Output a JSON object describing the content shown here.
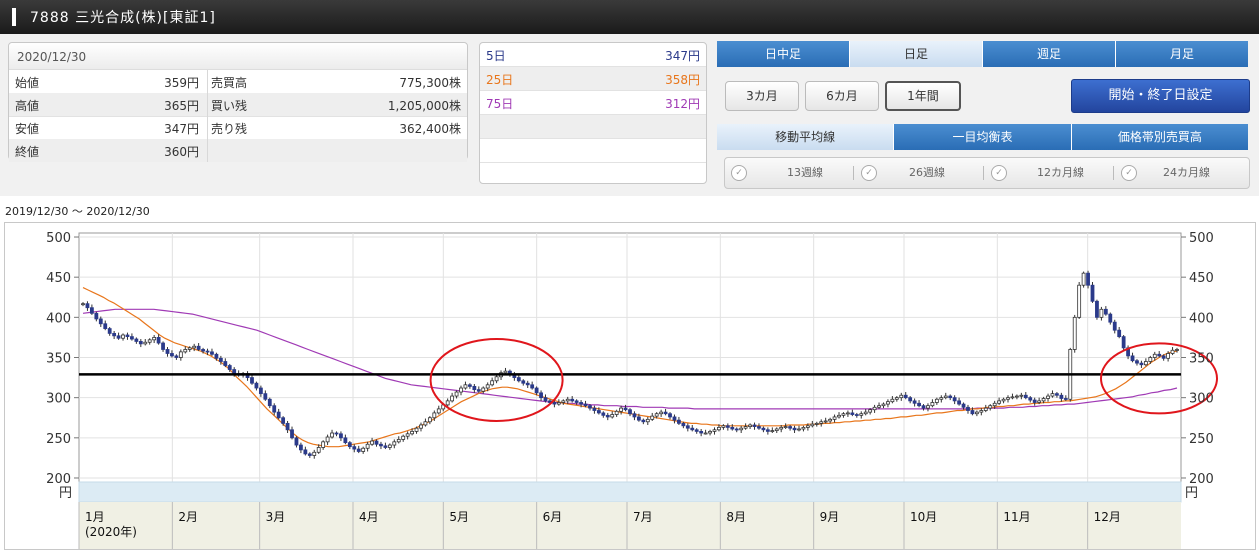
{
  "header": {
    "title": "7888 三光合成(株)[東証1]"
  },
  "quote": {
    "date": "2020/12/30",
    "rows": [
      {
        "label": "始値",
        "value": "359円",
        "label2": "売買高",
        "value2": "775,300株"
      },
      {
        "label": "高値",
        "value": "365円",
        "label2": "買い残",
        "value2": "1,205,000株"
      },
      {
        "label": "安値",
        "value": "347円",
        "label2": "売り残",
        "value2": "362,400株"
      },
      {
        "label": "終値",
        "value": "360円",
        "label2": "",
        "value2": ""
      }
    ]
  },
  "ma": {
    "rows": [
      {
        "label": "5日",
        "value": "347円",
        "color": "#2b3a8a"
      },
      {
        "label": "25日",
        "value": "358円",
        "color": "#e8761c"
      },
      {
        "label": "75日",
        "value": "312円",
        "color": "#a03ab5"
      }
    ]
  },
  "tabs": {
    "period": [
      "日中足",
      "日足",
      "週足",
      "月足"
    ],
    "period_selected": 1
  },
  "ranges": {
    "items": [
      "3カ月",
      "6カ月",
      "1年間"
    ],
    "selected": 2
  },
  "set_button": "開始・終了日設定",
  "tabs2": {
    "items": [
      "移動平均線",
      "一目均衡表",
      "価格帯別売買高"
    ],
    "selected": 0
  },
  "lines": {
    "items": [
      "13週線",
      "26週線",
      "12カ月線",
      "24カ月線"
    ]
  },
  "chart_range": "2019/12/30 〜 2020/12/30",
  "colors": {
    "up": "#ffffff",
    "down": "#2b3a8a",
    "ma25": "#e8761c",
    "ma75": "#a03ab5",
    "annotation": "#e0161c"
  },
  "chart_data": {
    "type": "candlestick",
    "ylim": [
      195,
      505
    ],
    "yticks": [
      200,
      250,
      300,
      350,
      400,
      450,
      500
    ],
    "y_unit": "円",
    "months": [
      "1月",
      "2月",
      "3月",
      "4月",
      "5月",
      "6月",
      "7月",
      "8月",
      "9月",
      "10月",
      "11月",
      "12月"
    ],
    "year_label": "(2020年)",
    "close": [
      417,
      412,
      405,
      398,
      392,
      386,
      380,
      377,
      374,
      378,
      376,
      373,
      370,
      367,
      369,
      372,
      375,
      368,
      360,
      355,
      352,
      350,
      357,
      360,
      362,
      364,
      360,
      358,
      357,
      354,
      349,
      345,
      340,
      335,
      330,
      328,
      330,
      325,
      318,
      312,
      305,
      298,
      290,
      282,
      275,
      268,
      260,
      250,
      241,
      235,
      230,
      228,
      232,
      238,
      245,
      251,
      256,
      255,
      250,
      244,
      239,
      236,
      233,
      237,
      242,
      246,
      242,
      240,
      238,
      241,
      245,
      248,
      252,
      255,
      258,
      262,
      266,
      270,
      275,
      281,
      286,
      291,
      296,
      302,
      307,
      312,
      316,
      314,
      310,
      308,
      312,
      316,
      321,
      326,
      331,
      333,
      329,
      325,
      321,
      318,
      316,
      312,
      306,
      300,
      296,
      294,
      292,
      294,
      296,
      298,
      296,
      294,
      292,
      290,
      287,
      284,
      281,
      278,
      276,
      279,
      283,
      287,
      285,
      280,
      276,
      272,
      270,
      273,
      277,
      280,
      282,
      280,
      276,
      272,
      268,
      265,
      262,
      260,
      258,
      256,
      256,
      258,
      260,
      263,
      265,
      263,
      261,
      260,
      262,
      264,
      266,
      264,
      262,
      260,
      258,
      259,
      261,
      263,
      264,
      262,
      260,
      261,
      263,
      265,
      267,
      268,
      270,
      271,
      273,
      276,
      278,
      280,
      281,
      279,
      278,
      280,
      282,
      285,
      288,
      290,
      292,
      295,
      298,
      300,
      303,
      300,
      296,
      293,
      290,
      287,
      290,
      294,
      298,
      300,
      302,
      300,
      296,
      292,
      288,
      284,
      280,
      282,
      284,
      287,
      290,
      293,
      296,
      298,
      300,
      301,
      302,
      303,
      300,
      297,
      294,
      296,
      299,
      302,
      305,
      303,
      299,
      298,
      360,
      400,
      440,
      455,
      440,
      420,
      400,
      410,
      404,
      394,
      384,
      376,
      362,
      352,
      346,
      343,
      341,
      345,
      350,
      354,
      352,
      349,
      355,
      359,
      360
    ],
    "ma25": [
      437,
      434,
      431,
      428,
      425,
      421,
      418,
      414,
      410,
      406,
      402,
      398,
      393,
      388,
      383,
      378,
      374,
      371,
      368,
      366,
      364,
      362,
      360,
      358,
      355,
      352,
      348,
      344,
      339,
      333,
      326,
      320,
      314,
      307,
      300,
      293,
      286,
      280,
      274,
      268,
      262,
      256,
      251,
      247,
      244,
      242,
      241,
      240,
      239,
      239,
      239,
      240,
      241,
      242,
      243,
      244,
      245,
      247,
      249,
      251,
      253,
      255,
      256,
      258,
      260,
      262,
      265,
      268,
      271,
      275,
      279,
      283,
      287,
      291,
      295,
      298,
      301,
      304,
      307,
      309,
      311,
      312,
      313,
      313,
      312,
      311,
      309,
      307,
      305,
      303,
      301,
      299,
      297,
      295,
      293,
      292,
      291,
      290,
      289,
      288,
      287,
      286,
      285,
      284,
      283,
      282,
      281,
      280,
      279,
      278,
      277,
      276,
      275,
      274,
      273,
      272,
      271,
      270,
      269,
      268,
      268,
      267,
      267,
      266,
      266,
      265,
      265,
      265,
      265,
      265,
      265,
      265,
      265,
      265,
      265,
      265,
      265,
      265,
      266,
      266,
      266,
      266,
      267,
      267,
      267,
      268,
      268,
      269,
      269,
      270,
      270,
      271,
      271,
      272,
      272,
      273,
      273,
      274,
      274,
      275,
      276,
      276,
      277,
      278,
      278,
      279,
      280,
      281,
      281,
      282,
      283,
      284,
      284,
      285,
      286,
      286,
      287,
      288,
      288,
      289,
      289,
      290,
      290,
      291,
      292,
      292,
      293,
      293,
      294,
      294,
      295,
      295,
      296,
      296,
      297,
      298,
      299,
      300,
      301,
      303,
      305,
      308,
      311,
      315,
      319,
      324,
      329,
      334,
      339,
      344,
      348,
      352,
      355,
      357,
      358
    ],
    "ma75": [
      405,
      406,
      407,
      408,
      409,
      410,
      410,
      410,
      410,
      410,
      410,
      410,
      409,
      408,
      407,
      406,
      405,
      404,
      402,
      400,
      398,
      396,
      394,
      392,
      390,
      388,
      386,
      384,
      381,
      378,
      375,
      372,
      369,
      366,
      363,
      360,
      357,
      354,
      351,
      348,
      345,
      342,
      339,
      336,
      333,
      330,
      327,
      324,
      322,
      320,
      318,
      316,
      315,
      314,
      313,
      312,
      311,
      310,
      309,
      308,
      307,
      306,
      305,
      304,
      303,
      302,
      301,
      300,
      299,
      298,
      297,
      296,
      295,
      294,
      294,
      293,
      293,
      292,
      292,
      291,
      291,
      290,
      290,
      290,
      289,
      289,
      289,
      288,
      288,
      288,
      288,
      287,
      287,
      287,
      287,
      286,
      286,
      286,
      286,
      286,
      286,
      286,
      286,
      286,
      286,
      286,
      286,
      286,
      286,
      286,
      286,
      286,
      286,
      286,
      286,
      286,
      286,
      286,
      286,
      286,
      286,
      286,
      286,
      286,
      286,
      286,
      286,
      286,
      286,
      286,
      286,
      286,
      286,
      286,
      286,
      286,
      286,
      286,
      286,
      287,
      287,
      287,
      287,
      287,
      288,
      288,
      288,
      289,
      289,
      290,
      290,
      291,
      291,
      292,
      292,
      293,
      294,
      295,
      296,
      297,
      298,
      299,
      300,
      301,
      303,
      304,
      306,
      307,
      309,
      310,
      312
    ],
    "reference_line": 329
  }
}
